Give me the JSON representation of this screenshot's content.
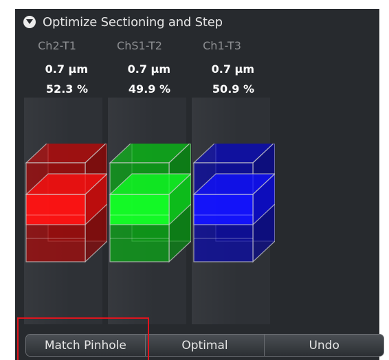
{
  "section": {
    "title": "Optimize Sectioning and Step",
    "expand_icon": "chevron-down-circle-icon"
  },
  "channels": [
    {
      "name": "Ch2-T1",
      "section_thickness": "0.7 µm",
      "step_percent": "52.3 %",
      "color": "#ee1111"
    },
    {
      "name": "ChS1-T2",
      "section_thickness": "0.7 µm",
      "step_percent": "49.9 %",
      "color": "#11ee22"
    },
    {
      "name": "Ch1-T3",
      "section_thickness": "0.7 µm",
      "step_percent": "50.9 %",
      "color": "#1111ee"
    }
  ],
  "buttons": {
    "match_pinhole": "Match Pinhole",
    "optimal": "Optimal",
    "undo": "Undo"
  },
  "colors": {
    "panel_background": "#272a2e",
    "highlight": "#e0141d"
  }
}
